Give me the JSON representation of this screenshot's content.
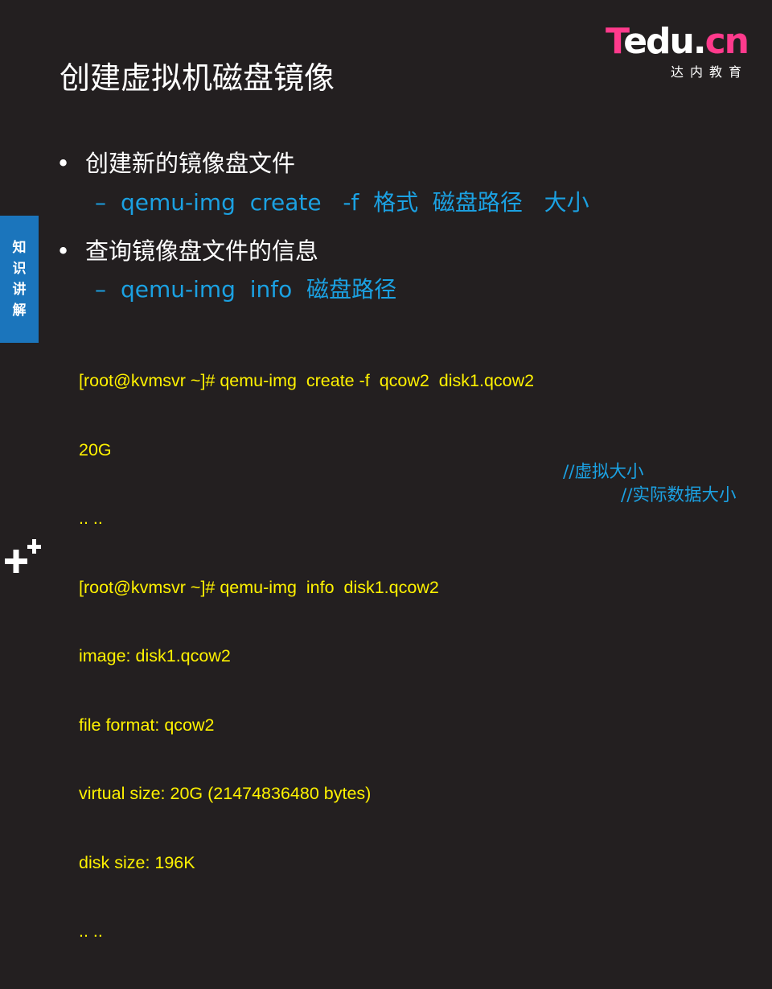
{
  "logo": {
    "brand_t": "T",
    "brand_rest": "edu.",
    "brand_cn": "cn",
    "subtitle": "达内教育"
  },
  "title": "创建虚拟机磁盘镜像",
  "side_tab": {
    "chars": [
      "知",
      "识",
      "讲",
      "解"
    ]
  },
  "bullets": [
    {
      "text": "创建新的镜像盘文件",
      "sub": "qemu-img  create   -f  格式  磁盘路径   大小"
    },
    {
      "text": "查询镜像盘文件的信息",
      "sub": "qemu-img  info  磁盘路径"
    }
  ],
  "bullet_glyph": "•",
  "sub_glyph": "–",
  "code_lines": [
    "[root@kvmsvr ~]# qemu-img  create -f  qcow2  disk1.qcow2",
    "20G",
    ".. ..",
    "[root@kvmsvr ~]# qemu-img  info  disk1.qcow2",
    "image: disk1.qcow2",
    "file format: qcow2",
    "virtual size: 20G (21474836480 bytes)",
    "disk size: 196K",
    ".. .."
  ],
  "comments": {
    "virtual_size": "//虚拟大小",
    "disk_size": "//实际数据大小"
  },
  "colors": {
    "background": "#231f20",
    "accent_blue": "#1ba1e2",
    "code_yellow": "#fff200",
    "tab_blue": "#1b75bc",
    "logo_pink": "#ff3a8c"
  }
}
